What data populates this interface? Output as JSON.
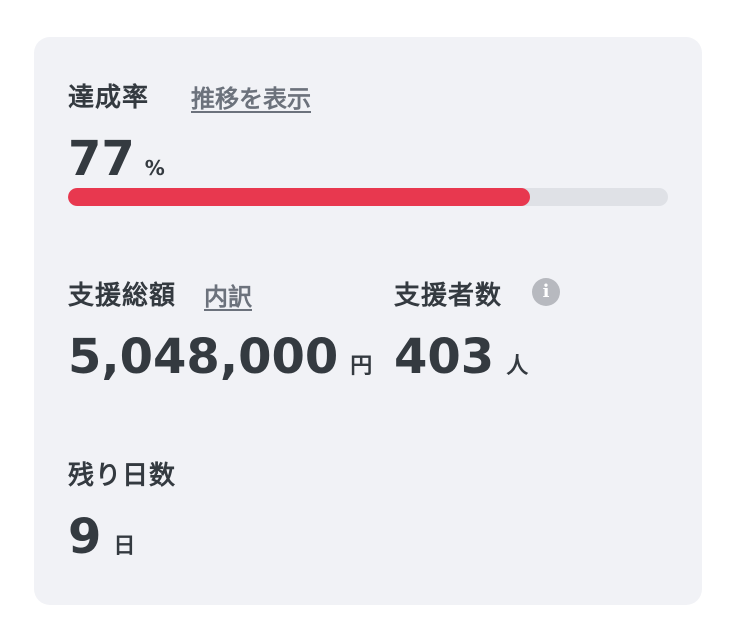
{
  "achievement": {
    "label": "達成率",
    "history_link": "推移を表示",
    "value": "77",
    "unit": "%",
    "progress_fraction": 0.77
  },
  "total_support": {
    "label": "支援総額",
    "breakdown_link": "内訳",
    "value": "5,048,000",
    "unit": "円"
  },
  "supporters": {
    "label": "支援者数",
    "info_icon": "info-icon",
    "info_glyph": "i",
    "value": "403",
    "unit": "人"
  },
  "days_left": {
    "label": "残り日数",
    "value": "9",
    "unit": "日"
  },
  "colors": {
    "card_bg": "#f1f2f6",
    "progress_fill": "#e8384f",
    "progress_track": "#dfe1e6",
    "text": "#343a40",
    "link": "#6c727c"
  }
}
